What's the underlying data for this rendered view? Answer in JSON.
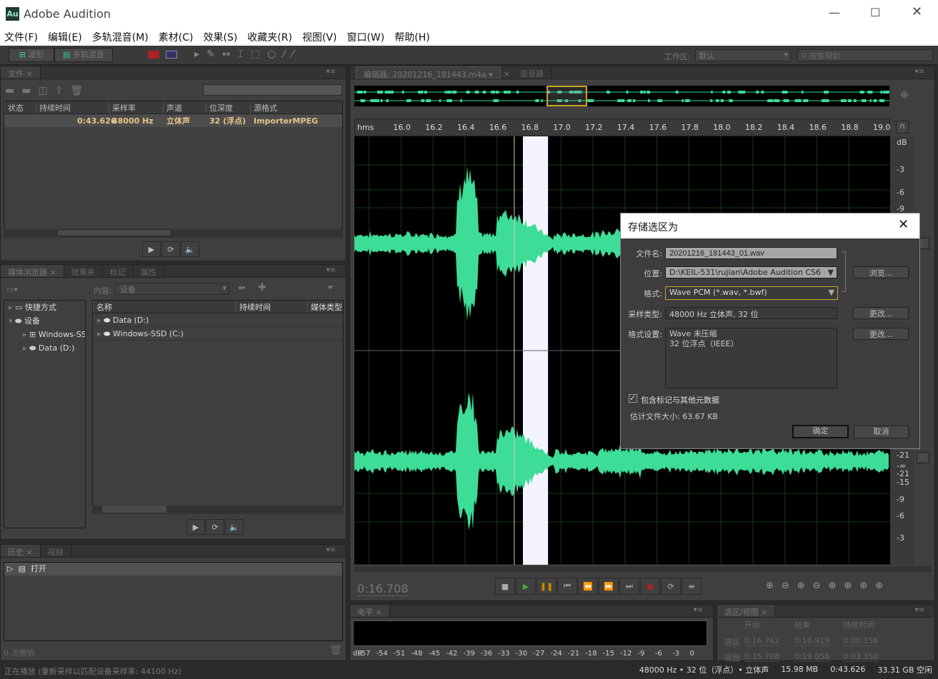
{
  "app": {
    "title": "Adobe Audition",
    "logo": "Au"
  },
  "menu": [
    "文件(F)",
    "编辑(E)",
    "多轨混音(M)",
    "素材(C)",
    "效果(S)",
    "收藏夹(R)",
    "视图(V)",
    "窗口(W)",
    "帮助(H)"
  ],
  "toolbar": {
    "waveform": "波形",
    "multitrack": "多轨混音",
    "workspace_label": "工作区:",
    "workspace_value": "默认",
    "search_placeholder": "搜索帮助"
  },
  "files_panel": {
    "tab": "文件",
    "columns": [
      "状态",
      "持续时间",
      "采样率",
      "声道",
      "位深度",
      "源格式"
    ],
    "row": [
      "",
      "0:43.626",
      "48000 Hz",
      "立体声",
      "32 (浮点)",
      "ImporterMPEG"
    ]
  },
  "media_panel": {
    "tabs": [
      "媒体浏览器",
      "效果夹",
      "标记",
      "属性"
    ],
    "content_label": "内容:",
    "content_value": "设备",
    "tree": [
      "快捷方式",
      "设备",
      "Windows-SSD (C:)",
      "Data (D:)"
    ],
    "columns": [
      "名称",
      "持续时间",
      "媒体类型"
    ],
    "rows": [
      "Data (D:)",
      "Windows-SSD (C:)"
    ]
  },
  "history_panel": {
    "tabs": [
      "历史",
      "视频"
    ],
    "items": [
      "打开"
    ],
    "undo_count": "0 次撤销"
  },
  "status_left": "正在播放 (重新采样以匹配设备采样率: 44100 Hz)",
  "editor": {
    "tab": "编辑器: 20201216_181443.m4a",
    "mixer_tab": "混音器",
    "ruler_unit": "hms",
    "ticks": [
      "16.0",
      "16.2",
      "16.4",
      "16.6",
      "16.8",
      "17.0",
      "17.2",
      "17.4",
      "17.6",
      "17.8",
      "18.0",
      "18.2",
      "18.4",
      "18.6",
      "18.8",
      "19.0"
    ],
    "db_top": [
      "dB",
      "-3",
      "-6",
      "-9"
    ],
    "db_bottom": [
      "-21",
      "-∞",
      "-21",
      "-15",
      "-9",
      "-6",
      "-3"
    ],
    "channel_L": "L",
    "channel_R": "R",
    "current_time": "0:16.708",
    "waveform_color": "#3ddc97",
    "selection_color": "#f4f4ff"
  },
  "levels": {
    "tab": "电平",
    "scale": [
      "dB",
      "-57",
      "-54",
      "-51",
      "-48",
      "-45",
      "-42",
      "-39",
      "-36",
      "-33",
      "-30",
      "-27",
      "-24",
      "-21",
      "-18",
      "-15",
      "-12",
      "-9",
      "-6",
      "-3",
      "0"
    ]
  },
  "selview": {
    "tab": "选区/视图",
    "headers": [
      "开始",
      "结束",
      "持续时间"
    ],
    "rows": [
      {
        "label": "选区",
        "start": "0:16.762",
        "end": "0:16.919",
        "dur": "0:00.156"
      },
      {
        "label": "视图",
        "start": "0:15.708",
        "end": "0:19.058",
        "dur": "0:03.350"
      }
    ]
  },
  "statusbar": [
    "48000 Hz • 32 位（浮点）• 立体声",
    "15.98 MB",
    "0:43.626",
    "33.31 GB 空闲"
  ],
  "dialog": {
    "title": "存储选区为",
    "filename_label": "文件名:",
    "filename": "20201216_181443_01.wav",
    "location_label": "位置:",
    "location": "D:\\KEIL-531\\rujian\\Adobe Audition CS6",
    "format_label": "格式:",
    "format": "Wave PCM (*.wav, *.bwf)",
    "sample_label": "采样类型:",
    "sample": "48000 Hz 立体声, 32 位",
    "settings_label": "格式设置:",
    "settings_line1": "Wave 未压缩",
    "settings_line2": "32 位浮点（IEEE）",
    "browse": "浏览...",
    "change1": "更改...",
    "change2": "更改...",
    "include_meta": "包含标记与其他元数据",
    "include_meta_checked": true,
    "est_size": "估计文件大小: 63.67 KB",
    "ok": "确定",
    "cancel": "取消"
  }
}
